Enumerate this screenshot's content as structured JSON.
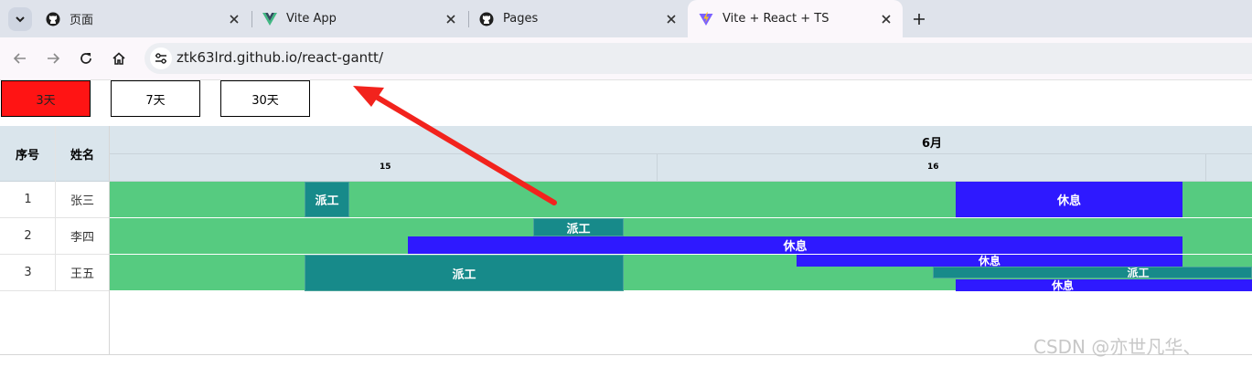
{
  "tabs": [
    {
      "title": "页面",
      "icon": "github-icon",
      "active": false
    },
    {
      "title": "Vite App",
      "icon": "vue-icon",
      "active": false
    },
    {
      "title": "Pages",
      "icon": "github-icon",
      "active": false
    },
    {
      "title": "Vite + React + TS",
      "icon": "vite-icon",
      "active": true
    }
  ],
  "address": {
    "url": "ztk63lrd.github.io/react-gantt/"
  },
  "range_buttons": [
    {
      "label": "3天",
      "selected": true
    },
    {
      "label": "7天",
      "selected": false
    },
    {
      "label": "30天",
      "selected": false
    }
  ],
  "table": {
    "headers": [
      "序号",
      "姓名"
    ],
    "rows": [
      {
        "index": "1",
        "name": "张三"
      },
      {
        "index": "2",
        "name": "李四"
      },
      {
        "index": "3",
        "name": "王五"
      }
    ]
  },
  "timeline": {
    "month": "6月",
    "days": [
      "15",
      "16"
    ]
  },
  "tasks": {
    "work_label": "派工",
    "rest_label": "休息"
  },
  "colors": {
    "selected_button": "#ff1414",
    "lane": "#56cb80",
    "work": "#178a8a",
    "rest": "#2e19ff",
    "header": "#dae5ec"
  },
  "watermark": "CSDN @亦世凡华、"
}
